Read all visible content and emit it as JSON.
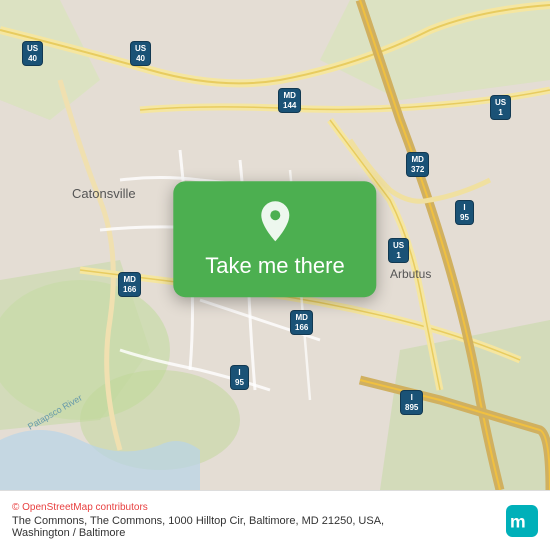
{
  "map": {
    "background_color": "#e8e0d8",
    "roads": {
      "us40": "US 40",
      "md144": "MD 144",
      "md372": "MD 372",
      "md166": "MD 166",
      "us1": "US 1",
      "i95": "I 95",
      "i895": "I 895"
    },
    "places": {
      "catonsville": "Catonsville",
      "arbutus": "Arbutus"
    }
  },
  "overlay": {
    "button_label": "Take me there",
    "pin_color": "#4CAF50"
  },
  "footer": {
    "osm_credit_prefix": "© ",
    "osm_credit_link": "OpenStreetMap",
    "osm_credit_suffix": " contributors",
    "address": "The Commons, The Commons, 1000 Hilltop Cir, Baltimore, MD 21250, USA, Washington / Baltimore"
  }
}
